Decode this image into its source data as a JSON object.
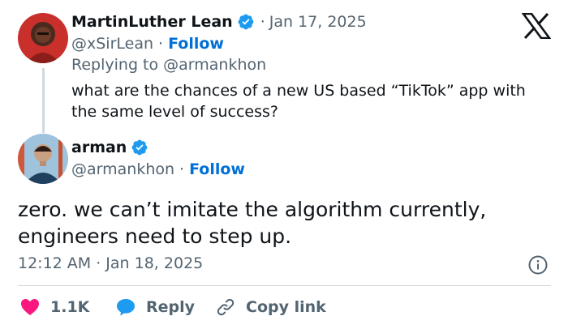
{
  "reply": {
    "display_name": "MartinLuther Lean",
    "date": "Jan 17, 2025",
    "handle": "@xSirLean",
    "follow_label": "Follow",
    "replying_to": "Replying to @armankhon",
    "text": "what are the chances of a new US based “TikTok” app with the same level of success?"
  },
  "main": {
    "display_name": "arman",
    "handle": "@armankhon",
    "follow_label": "Follow",
    "text": "zero. we can’t imitate the algorithm currently, engineers need to step up.",
    "timestamp": "12:12 AM · Jan 18, 2025"
  },
  "actions": {
    "like_count": "1.1K",
    "reply_label": "Reply",
    "copy_label": "Copy link"
  },
  "separator": "·",
  "colors": {
    "accent": "#006fd6",
    "verified": "#1d9bf0",
    "like": "#f91880",
    "reply_icon": "#1d9bf0",
    "muted": "#536471",
    "text": "#0f1419",
    "divider": "#cfd9de"
  },
  "icons": {
    "brand": "x-logo-icon",
    "verified": "verified-badge-icon",
    "info": "info-icon",
    "like": "heart-icon",
    "reply": "speech-bubble-icon",
    "copy": "link-icon"
  }
}
